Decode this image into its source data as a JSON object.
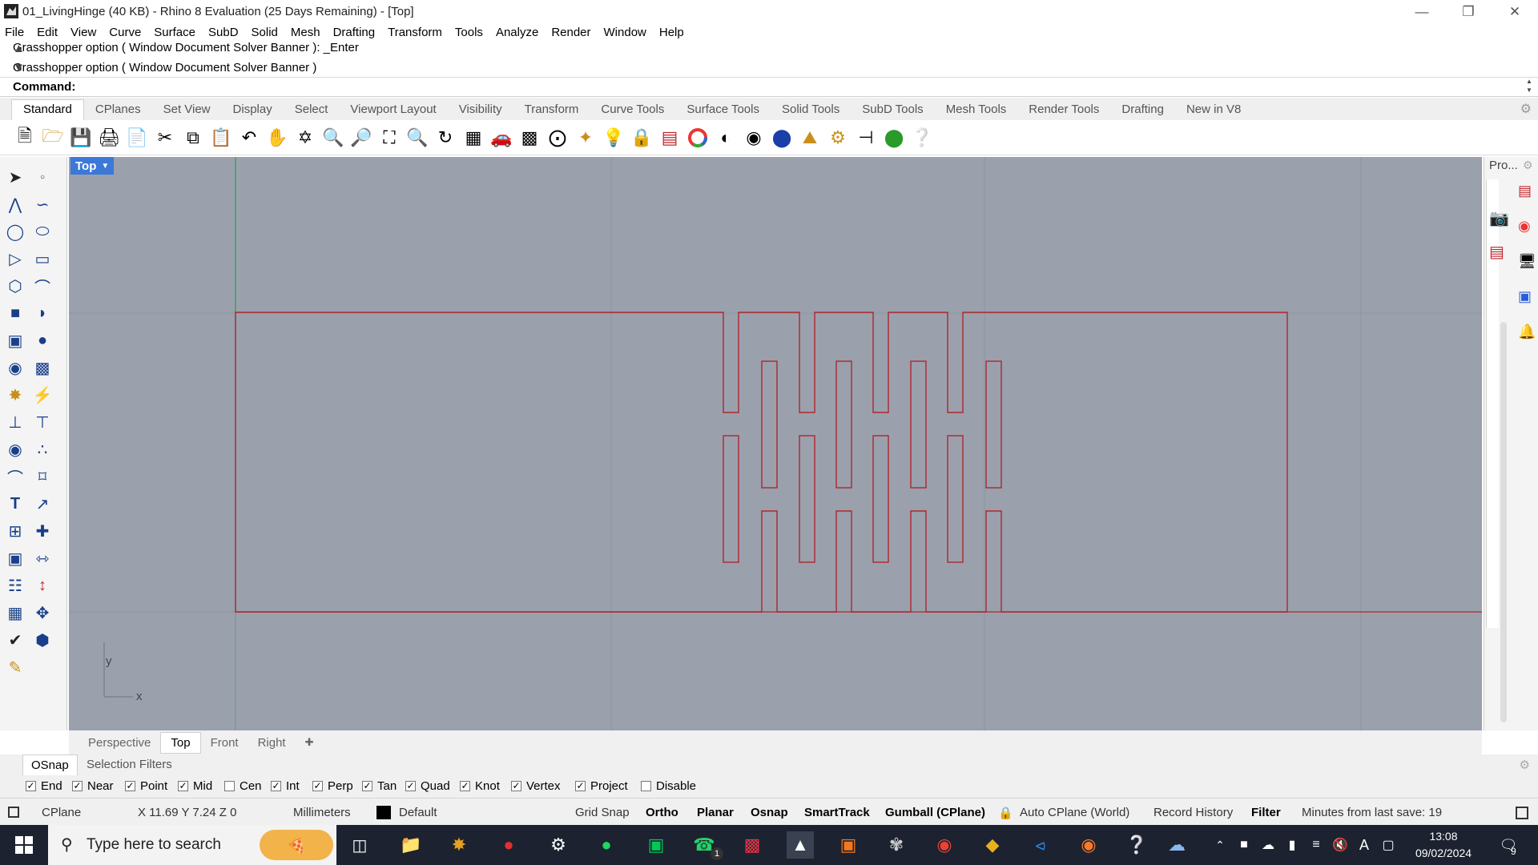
{
  "window": {
    "title": "01_LivingHinge (40 KB) - Rhino 8 Evaluation (25 Days Remaining) - [Top]",
    "minimize": "—",
    "restore": "❐",
    "close": "✕"
  },
  "menu": [
    "File",
    "Edit",
    "View",
    "Curve",
    "Surface",
    "SubD",
    "Solid",
    "Mesh",
    "Drafting",
    "Transform",
    "Tools",
    "Analyze",
    "Render",
    "Window",
    "Help"
  ],
  "command": {
    "history_1": "Grasshopper option ( Window  Document  Solver  Banner ): _Enter",
    "history_2": "Grasshopper option ( Window  Document  Solver  Banner )",
    "prompt_label": "Command:"
  },
  "toolbar_tabs": [
    "Standard",
    "CPlanes",
    "Set View",
    "Display",
    "Select",
    "Viewport Layout",
    "Visibility",
    "Transform",
    "Curve Tools",
    "Surface Tools",
    "Solid Tools",
    "SubD Tools",
    "Mesh Tools",
    "Render Tools",
    "Drafting",
    "New in V8"
  ],
  "active_toolbar_tab": "Standard",
  "viewport": {
    "label": "Top",
    "axis_x": "x",
    "axis_y": "y"
  },
  "right_panel": {
    "label": "Pro..."
  },
  "viewport_tabs": [
    "Perspective",
    "Top",
    "Front",
    "Right"
  ],
  "active_viewport_tab": "Top",
  "osnap": {
    "tabs": [
      "OSnap",
      "Selection Filters"
    ],
    "side_label": "Osnap",
    "options": [
      {
        "label": "End",
        "checked": true
      },
      {
        "label": "Near",
        "checked": true
      },
      {
        "label": "Point",
        "checked": true
      },
      {
        "label": "Mid",
        "checked": true
      },
      {
        "label": "Cen",
        "checked": false
      },
      {
        "label": "Int",
        "checked": true
      },
      {
        "label": "Perp",
        "checked": true
      },
      {
        "label": "Tan",
        "checked": true
      },
      {
        "label": "Quad",
        "checked": true
      },
      {
        "label": "Knot",
        "checked": true
      },
      {
        "label": "Vertex",
        "checked": true
      },
      {
        "label": "Project",
        "checked": true
      },
      {
        "label": "Disable",
        "checked": false
      }
    ]
  },
  "status": {
    "cplane": "CPlane",
    "coords": "X 11.69 Y 7.24 Z 0",
    "units": "Millimeters",
    "layer": "Default",
    "grid_snap": "Grid Snap",
    "ortho": "Ortho",
    "planar": "Planar",
    "osnap": "Osnap",
    "smarttrack": "SmartTrack",
    "gumball": "Gumball (CPlane)",
    "auto_cplane": "Auto CPlane (World)",
    "record_history": "Record History",
    "filter": "Filter",
    "minutes": "Minutes from last save: 19"
  },
  "taskbar": {
    "search_placeholder": "Type here to search",
    "time": "13:08",
    "date": "09/02/2024",
    "notification_count": "9",
    "whatsapp_badge": "1"
  },
  "colors": {
    "viewport_bg": "#9aa1ad",
    "curve": "#b0262d",
    "grid_major": "#8b929e",
    "y_axis": "#2f9e3a",
    "x_axis": "#b0262d",
    "accent": "#3b78d8"
  }
}
